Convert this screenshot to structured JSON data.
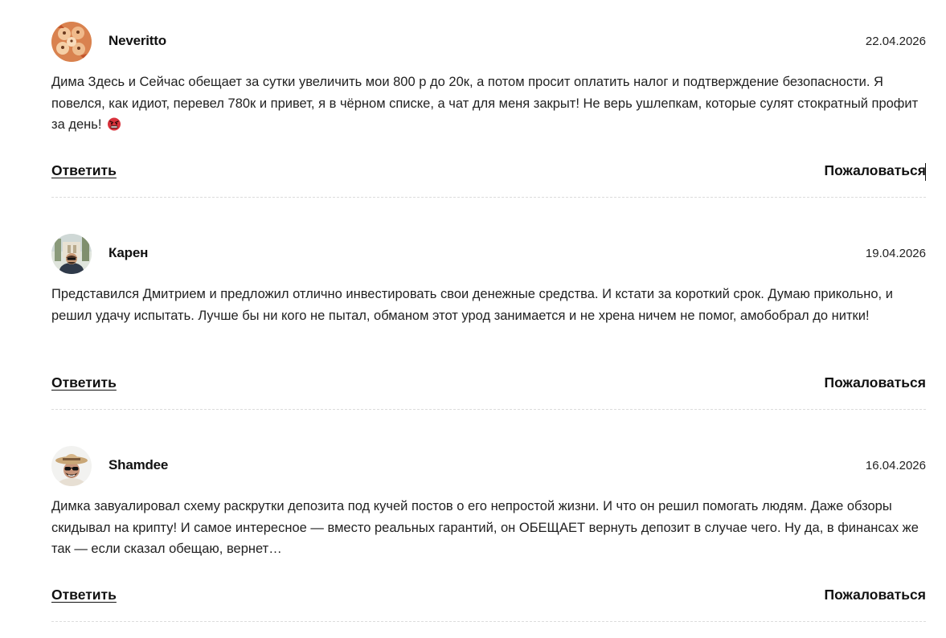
{
  "comments": [
    {
      "author": "Neveritto",
      "date": "22.04.2026",
      "avatar": "collage-avatar",
      "text": "Дима Здесь и Сейчас обещает за сутки увеличить мои 800 р до 20к, а потом просит оплатить налог и подтверждение безопасности. Я повелся, как идиот, перевел 780к и привет, я в чёрном списке, а чат для меня закрыт! Не верь ушлепкам, которые сулят стократный профит за день!",
      "emoji": "angry-face-emoji",
      "reply_label": "Ответить",
      "report_label": "Пожаловаться"
    },
    {
      "author": "Карен",
      "date": "19.04.2026",
      "avatar": "man-outdoor-avatar",
      "text": "Представился Дмитрием и предложил отлично инвестировать свои денежные средства. И кстати за короткий срок. Думаю прикольно, и решил удачу испытать. Лучше бы ни кого не пытал, обманом этот урод занимается и не хрена ничем не помог, амобобрал до нитки!",
      "reply_label": "Ответить",
      "report_label": "Пожаловаться"
    },
    {
      "author": "Shamdee",
      "date": "16.04.2026",
      "avatar": "man-hat-sunglasses-avatar",
      "text": "Димка завуалировал схему раскрутки депозита под кучей постов о его непростой жизни. И что он решил помогать людям. Даже обзоры скидывал на крипту! И самое интересное — вместо реальных гарантий, он ОБЕЩАЕТ вернуть депозит в случае чего. Ну да, в финансах же так — если сказал обещаю, вернет…",
      "reply_label": "Ответить",
      "report_label": "Пожаловаться"
    }
  ]
}
